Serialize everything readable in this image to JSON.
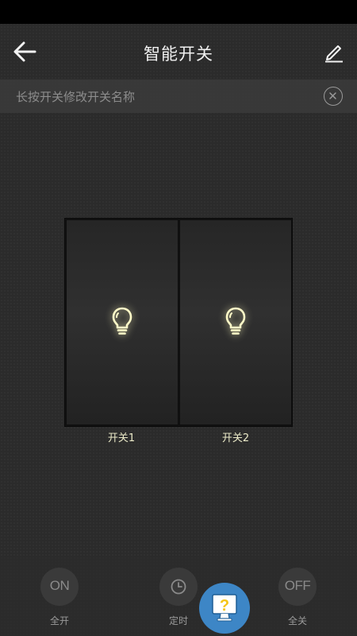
{
  "header": {
    "title": "智能开关",
    "back_icon": "arrow-left-icon",
    "edit_icon": "pencil-icon"
  },
  "hint": {
    "text": "长按开关修改开关名称",
    "close_icon": "close-circle-icon"
  },
  "switches": [
    {
      "label": "开关1",
      "icon": "lightbulb-icon",
      "state": "on"
    },
    {
      "label": "开关2",
      "icon": "lightbulb-icon",
      "state": "on"
    }
  ],
  "actions": {
    "all_on": {
      "icon_text": "ON",
      "label": "全开"
    },
    "timer": {
      "icon": "clock-icon",
      "label": "定时"
    },
    "all_off": {
      "icon_text": "OFF",
      "label": "全关"
    }
  },
  "help": {
    "icon": "question-monitor-icon",
    "icon_text": "?"
  },
  "colors": {
    "background": "#2b2b2b",
    "bulb_glow": "#fffbc8",
    "switch_label": "#ecebc9",
    "fab": "#3d86c6",
    "fab_icon": "#f5c518"
  }
}
